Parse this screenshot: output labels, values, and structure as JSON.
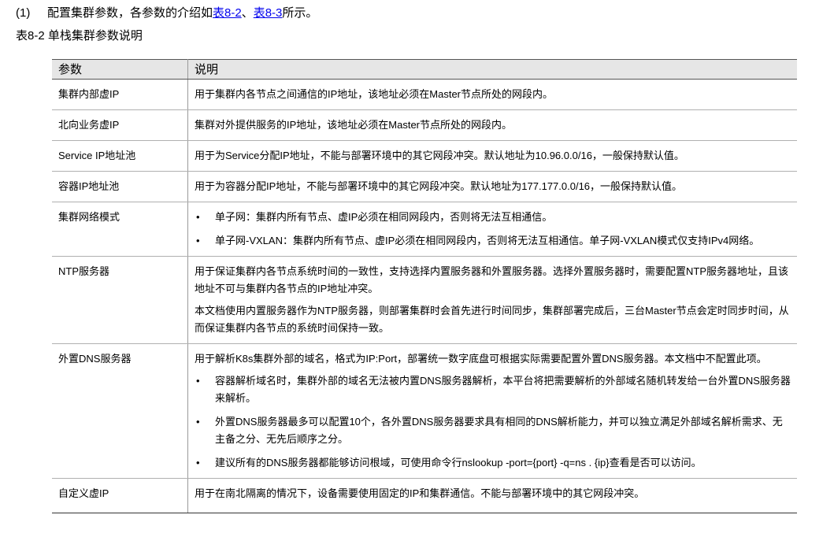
{
  "intro": {
    "num": "(1)",
    "text_before": "配置集群参数，各参数的介绍如",
    "link1": "表8-2",
    "sep": "、",
    "link2": "表8-3",
    "text_after": "所示。"
  },
  "caption": "表8-2 单栈集群参数说明",
  "table": {
    "headers": [
      "参数",
      "说明"
    ],
    "rows": [
      {
        "param": "集群内部虚IP",
        "paras": [
          "用于集群内各节点之间通信的IP地址，该地址必须在Master节点所处的网段内。"
        ]
      },
      {
        "param": "北向业务虚IP",
        "paras": [
          "集群对外提供服务的IP地址，该地址必须在Master节点所处的网段内。"
        ]
      },
      {
        "param": "Service IP地址池",
        "paras": [
          "用于为Service分配IP地址，不能与部署环境中的其它网段冲突。默认地址为10.96.0.0/16，一般保持默认值。"
        ]
      },
      {
        "param": "容器IP地址池",
        "paras": [
          "用于为容器分配IP地址，不能与部署环境中的其它网段冲突。默认地址为177.177.0.0/16，一般保持默认值。"
        ]
      },
      {
        "param": "集群网络模式",
        "bullets": [
          "单子网：集群内所有节点、虚IP必须在相同网段内，否则将无法互相通信。",
          "单子网-VXLAN：集群内所有节点、虚IP必须在相同网段内，否则将无法互相通信。单子网-VXLAN模式仅支持IPv4网络。"
        ]
      },
      {
        "param": "NTP服务器",
        "paras": [
          "用于保证集群内各节点系统时间的一致性，支持选择内置服务器和外置服务器。选择外置服务器时，需要配置NTP服务器地址，且该地址不可与集群内各节点的IP地址冲突。",
          "本文档使用内置服务器作为NTP服务器，则部署集群时会首先进行时间同步，集群部署完成后，三台Master节点会定时同步时间，从而保证集群内各节点的系统时间保持一致。"
        ]
      },
      {
        "param": "外置DNS服务器",
        "paras": [
          "用于解析K8s集群外部的域名，格式为IP:Port，部署统一数字底盘可根据实际需要配置外置DNS服务器。本文档中不配置此项。"
        ],
        "bullets": [
          "容器解析域名时，集群外部的域名无法被内置DNS服务器解析，本平台将把需要解析的外部域名随机转发给一台外置DNS服务器来解析。",
          "外置DNS服务器最多可以配置10个，各外置DNS服务器要求具有相同的DNS解析能力，并可以独立满足外部域名解析需求、无主备之分、无先后顺序之分。",
          "建议所有的DNS服务器都能够访问根域，可使用命令行nslookup -port={port} -q=ns . {ip}查看是否可以访问。"
        ]
      },
      {
        "param": "自定义虚IP",
        "paras": [
          "用于在南北隔离的情况下，设备需要使用固定的IP和集群通信。不能与部署环境中的其它网段冲突。"
        ]
      }
    ]
  }
}
